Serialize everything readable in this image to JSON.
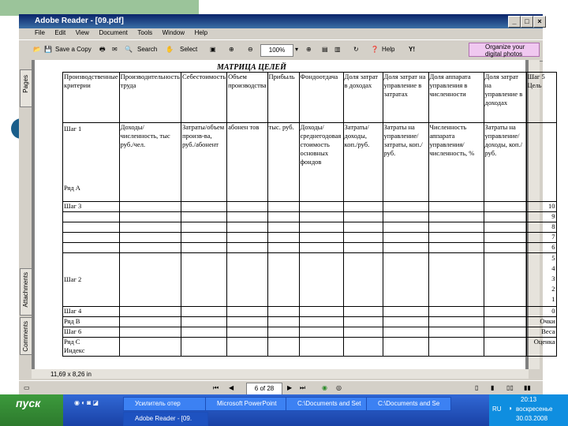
{
  "window": {
    "title": "Adobe Reader - [09.pdf]"
  },
  "menu": [
    "File",
    "Edit",
    "View",
    "Document",
    "Tools",
    "Window",
    "Help"
  ],
  "toolbar": {
    "save_label": "Save a Copy",
    "search_label": "Search",
    "select_label": "Select",
    "zoom": "100%",
    "help_label": "Help",
    "ad_line1": "Organize your",
    "ad_line2": "digital photos"
  },
  "sidetabs": {
    "pages": "Pages",
    "attachments": "Attachments",
    "comments": "Comments"
  },
  "document": {
    "page_size": "11,69 x 8,26 in",
    "title": "МАТРИЦА ЦЕЛЕЙ",
    "header": [
      "Производственные критерии",
      "Производительность труда",
      "Себестоимость",
      "Объем производства",
      "Прибыль",
      "Фондоотдача",
      "Доля затрат в доходах",
      "Доля затрат на управление в затратах",
      "Доля аппарата управления в численности",
      "Доля затрат на управление в доходах",
      "Шаг 5 Цель"
    ],
    "step1": [
      "Шаг 1",
      "Доходы/численность, тыс руб./чел.",
      "Затраты/объем произв-ва, руб./абонент",
      "абонен тов",
      "тыс. руб.",
      "Доходы/среднегодовая стоимость основных фондов",
      "Затраты/доходы, коп./руб.",
      "Затраты на управление/затраты, коп./руб.",
      "Численность аппарата управления/численность, %",
      "Затраты на управление/доходы, коп./руб."
    ],
    "row_a": "Ряд А",
    "step3": "Шаг 3",
    "step2": "Шаг 2",
    "step4": "Шаг 4",
    "row_b": "Ряд В",
    "step6": "Шаг 6",
    "row_c": "Ряд С",
    "index": "Индекс",
    "scores": [
      "10",
      "9",
      "8",
      "7",
      "6",
      "5",
      "4",
      "3",
      "2",
      "1",
      "0"
    ],
    "points": "Очки",
    "weight": "Веса",
    "rating": "Оценка"
  },
  "statusbar": {
    "page_indicator": "6 of 28"
  },
  "taskbar": {
    "start": "пуск",
    "tasks": [
      "Усилитель отер",
      "Adobe Reader - [09.",
      "Microsoft PowerPoint",
      "C:\\Documents and Set",
      "C:\\Documents and Se"
    ],
    "lang": "RU",
    "time": "20:13",
    "day": "воскресенье",
    "date": "30.03.2008"
  }
}
